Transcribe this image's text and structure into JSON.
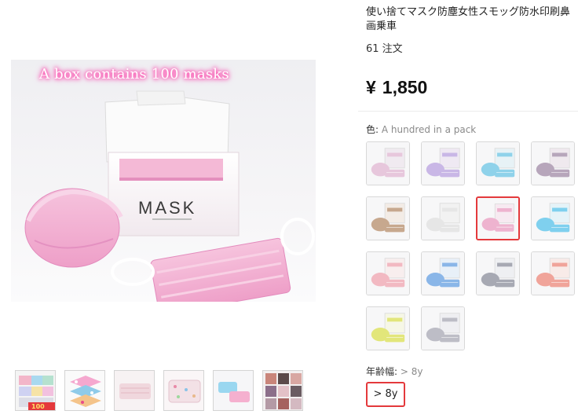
{
  "product": {
    "title_line1": "使い捨てマスク防塵女性スモッグ防水印刷鼻",
    "title_line2": "画乗車",
    "orders": "61 注文",
    "price_currency": "¥",
    "price_value": "1,850"
  },
  "main_image": {
    "caption": "A box contains 100 masks",
    "box_label": "MASK"
  },
  "thumbnails": [
    {
      "name": "thumb-1",
      "badge": "100"
    },
    {
      "name": "thumb-2"
    },
    {
      "name": "thumb-3"
    },
    {
      "name": "thumb-4"
    },
    {
      "name": "thumb-5"
    },
    {
      "name": "thumb-6"
    }
  ],
  "color": {
    "label": "色:",
    "selected": "A hundred in a pack",
    "swatches": [
      {
        "mask": "#e7c7dc",
        "box": "#f0eaf0",
        "sel": false
      },
      {
        "mask": "#c9b7e6",
        "box": "#efe9f3",
        "sel": false
      },
      {
        "mask": "#8fd2ea",
        "box": "#e7f2f6",
        "sel": false
      },
      {
        "mask": "#b7a6bb",
        "box": "#efe9ee",
        "sel": false
      },
      {
        "mask": "#c7a88e",
        "box": "#f3ece6",
        "sel": false
      },
      {
        "mask": "#e6e6e6",
        "box": "#f2f2f2",
        "sel": false
      },
      {
        "mask": "#eeb3cf",
        "box": "#f7eaf1",
        "sel": true
      },
      {
        "mask": "#7fd0ee",
        "box": "#e5f3f8",
        "sel": false
      },
      {
        "mask": "#f2b9c2",
        "box": "#f8eeee",
        "sel": false
      },
      {
        "mask": "#8ab6e8",
        "box": "#e8f0f8",
        "sel": false
      },
      {
        "mask": "#a7a9b3",
        "box": "#eeeff2",
        "sel": false
      },
      {
        "mask": "#f0a49a",
        "box": "#f8ebe8",
        "sel": false
      },
      {
        "mask": "#e2e67a",
        "box": "#f6f7e6",
        "sel": false
      },
      {
        "mask": "#bdbdc6",
        "box": "#efeff2",
        "sel": false
      }
    ]
  },
  "age": {
    "label": "年齢幅:",
    "selected": "> 8y",
    "option": "> 8y"
  },
  "colors": {
    "accent": "#e4393c",
    "glow": "#ff3fa8"
  }
}
